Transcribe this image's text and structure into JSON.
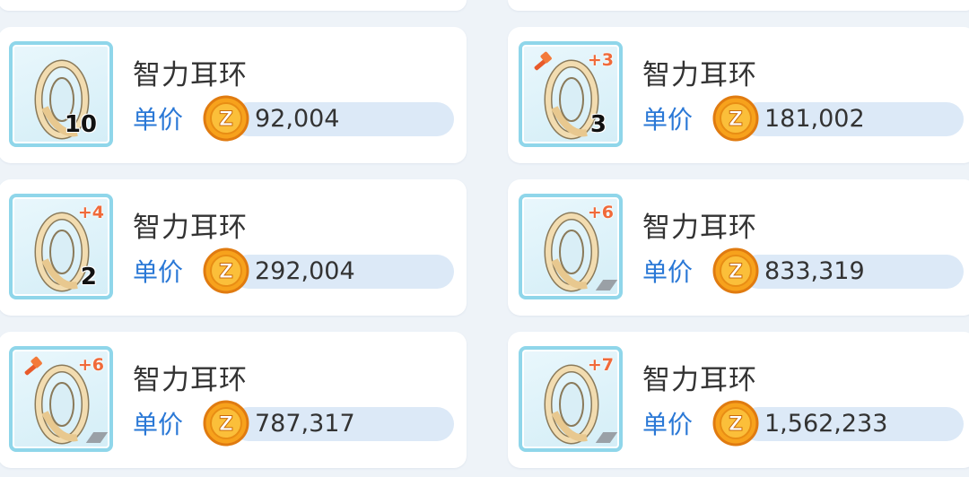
{
  "colors": {
    "background": "#eef3f8",
    "card": "#ffffff",
    "icon_border": "#8fd6ea",
    "refine_text": "#f06a3a",
    "price_label": "#2a78d6",
    "price_bar": "#dce9f7",
    "coin": "#f7a21c"
  },
  "coin_symbol": "Z",
  "listings": [
    {
      "name": "智力耳环",
      "price_label": "单价",
      "price": "92,004",
      "refine": "",
      "quantity": "10",
      "has_hammer": false
    },
    {
      "name": "智力耳环",
      "price_label": "单价",
      "price": "181,002",
      "refine": "+3",
      "quantity": "3",
      "has_hammer": true
    },
    {
      "name": "智力耳环",
      "price_label": "单价",
      "price": "292,004",
      "refine": "+4",
      "quantity": "2",
      "has_hammer": false
    },
    {
      "name": "智力耳环",
      "price_label": "单价",
      "price": "833,319",
      "refine": "+6",
      "quantity": "",
      "has_hammer": false
    },
    {
      "name": "智力耳环",
      "price_label": "单价",
      "price": "787,317",
      "refine": "+6",
      "quantity": "",
      "has_hammer": true
    },
    {
      "name": "智力耳环",
      "price_label": "单价",
      "price": "1,562,233",
      "refine": "+7",
      "quantity": "",
      "has_hammer": false
    }
  ]
}
